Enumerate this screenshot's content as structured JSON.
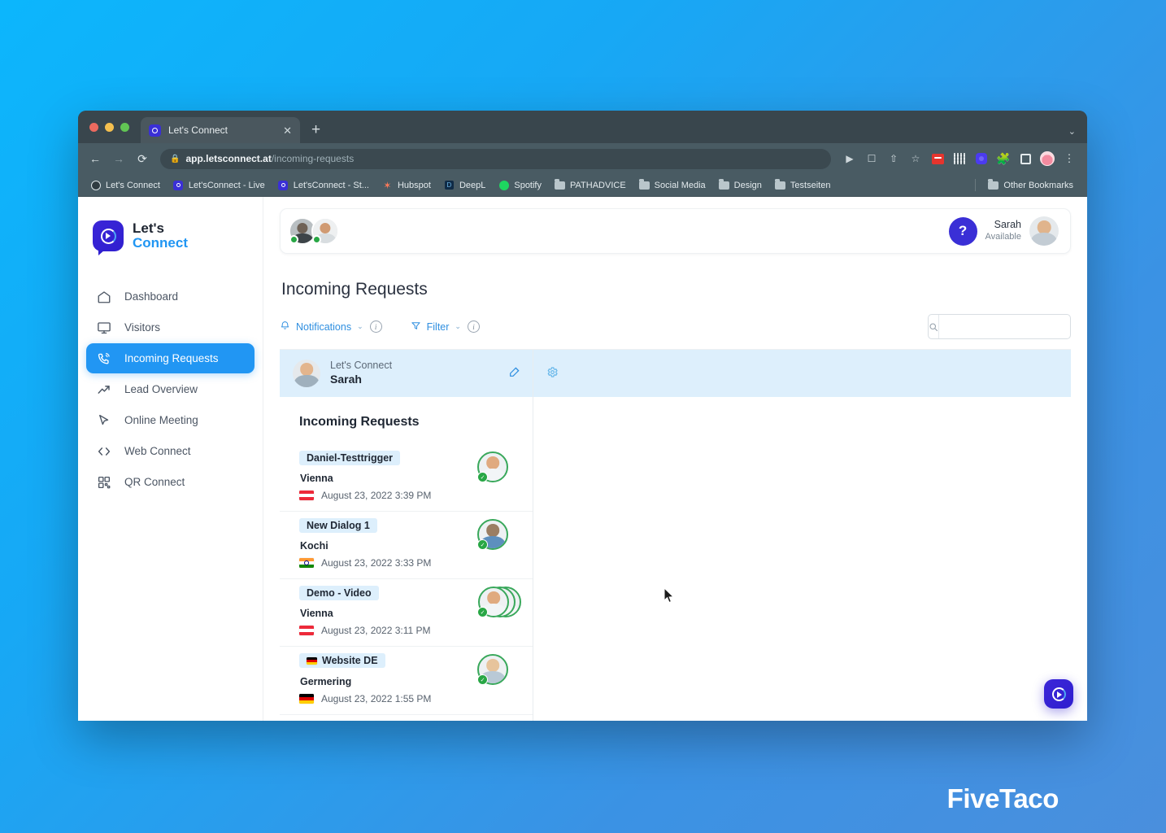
{
  "browser": {
    "tab": {
      "title": "Let's Connect",
      "favicon": "letsconnect-icon",
      "close_label": "✕"
    },
    "new_tab_label": "+",
    "tabstrip_caret": "⌄",
    "nav": {
      "back": "←",
      "forward": "→",
      "reload": "⟳"
    },
    "omnibox": {
      "lock_icon": "lock-icon",
      "domain": "app.letsconnect.at",
      "path": "/incoming-requests"
    },
    "toolbar_icons": [
      "media-cast-icon",
      "open-in-new-icon",
      "share-icon",
      "bookmark-star-icon",
      "extension-red-icon",
      "extension-qr-icon",
      "extension-blue-icon",
      "extensions-puzzle-icon",
      "reading-list-icon",
      "profile-avatar-icon",
      "three-dot-menu-icon"
    ],
    "bookmarks": [
      {
        "label": "Let's Connect",
        "icon": "globe-favicon"
      },
      {
        "label": "Let'sConnect - Live",
        "icon": "letsconnect-favicon"
      },
      {
        "label": "Let'sConnect - St...",
        "icon": "letsconnect-favicon"
      },
      {
        "label": "Hubspot",
        "icon": "hubspot-favicon"
      },
      {
        "label": "DeepL",
        "icon": "deepl-favicon"
      },
      {
        "label": "Spotify",
        "icon": "spotify-favicon"
      },
      {
        "label": "PATHADVICE",
        "icon": "folder-icon"
      },
      {
        "label": "Social Media",
        "icon": "folder-icon"
      },
      {
        "label": "Design",
        "icon": "folder-icon"
      },
      {
        "label": "Testseiten",
        "icon": "folder-icon"
      }
    ],
    "other_bookmarks": {
      "label": "Other Bookmarks",
      "icon": "folder-icon"
    }
  },
  "sidebar": {
    "brand": {
      "line1": "Let's",
      "line2": "Connect"
    },
    "items": [
      {
        "label": "Dashboard",
        "icon": "home-icon",
        "active": false
      },
      {
        "label": "Visitors",
        "icon": "monitor-icon",
        "active": false
      },
      {
        "label": "Incoming Requests",
        "icon": "phone-ring-icon",
        "active": true
      },
      {
        "label": "Lead Overview",
        "icon": "trend-up-icon",
        "active": false
      },
      {
        "label": "Online Meeting",
        "icon": "cursor-arrow-icon",
        "active": false
      },
      {
        "label": "Web Connect",
        "icon": "code-brackets-icon",
        "active": false
      },
      {
        "label": "QR Connect",
        "icon": "qr-code-icon",
        "active": false
      }
    ]
  },
  "topbar": {
    "help_label": "?",
    "user": {
      "name": "Sarah",
      "status": "Available"
    }
  },
  "page": {
    "title": "Incoming Requests",
    "notifications": {
      "label": "Notifications",
      "caret": "⌄",
      "info": "i"
    },
    "filter": {
      "label": "Filter",
      "caret": "⌄",
      "info": "i"
    },
    "search": {
      "value": "",
      "placeholder": ""
    }
  },
  "list": {
    "header": {
      "org": "Let's Connect",
      "name": "Sarah",
      "edit_icon": "edit-pencil-icon"
    },
    "section_title": "Incoming Requests",
    "items": [
      {
        "tag": "Daniel-Testtrigger",
        "tag_flag": "",
        "city": "Vienna",
        "flag": "at",
        "time": "August 23, 2022 3:39 PM",
        "avatar_count": 1,
        "verified": true
      },
      {
        "tag": "New Dialog 1",
        "tag_flag": "",
        "city": "Kochi",
        "flag": "in",
        "time": "August 23, 2022 3:33 PM",
        "avatar_count": 1,
        "verified": true
      },
      {
        "tag": "Demo - Video",
        "tag_flag": "",
        "city": "Vienna",
        "flag": "at",
        "time": "August 23, 2022 3:11 PM",
        "avatar_count": 3,
        "verified": true
      },
      {
        "tag": "Website DE",
        "tag_flag": "de",
        "city": "Germering",
        "flag": "de",
        "time": "August 23, 2022 1:55 PM",
        "avatar_count": 1,
        "verified": true
      }
    ]
  },
  "detail": {
    "gear_icon": "settings-gear-icon"
  },
  "widget": {
    "fab_icon": "letsconnect-widget-icon"
  },
  "watermark": {
    "text": "FiveTaco"
  },
  "colors": {
    "accent_blue": "#2196f3",
    "brand_indigo": "#3a2fd6",
    "online_green": "#28a745",
    "panel_highlight": "#ddeffc",
    "page_bg_start": "#0cb6fc",
    "page_bg_end": "#4a8fdd"
  }
}
